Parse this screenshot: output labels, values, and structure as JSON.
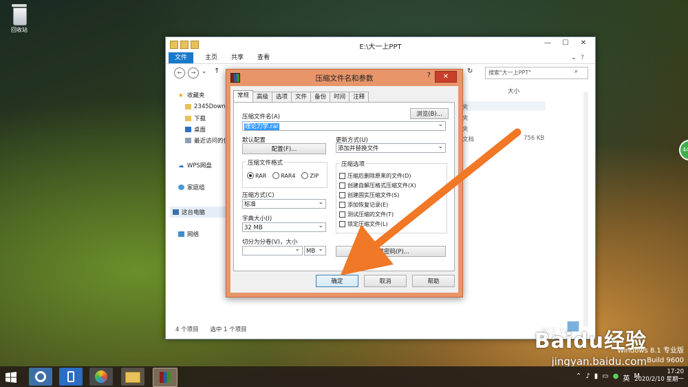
{
  "desktop": {
    "recycle_bin_label": "回收站"
  },
  "explorer": {
    "title": "E:\\大一上PPT",
    "ribbon_tabs": [
      "文件",
      "主页",
      "共享",
      "查看"
    ],
    "search_placeholder": "搜索\"大一上PPT\"",
    "nav_items": [
      {
        "label": "收藏夹",
        "icon": "star-icon"
      },
      {
        "label": "2345Down",
        "icon": "folder-icon"
      },
      {
        "label": "下载",
        "icon": "download-folder-icon"
      },
      {
        "label": "桌面",
        "icon": "desktop-icon"
      },
      {
        "label": "最近访问的位",
        "icon": "recent-icon"
      },
      {
        "label": "WPS网盘",
        "icon": "cloud-icon"
      },
      {
        "label": "家庭组",
        "icon": "homegroup-icon"
      },
      {
        "label": "这台电脑",
        "icon": "computer-icon"
      },
      {
        "label": "网络",
        "icon": "network-icon"
      }
    ],
    "column_size": "大小",
    "partial_types": [
      "夹",
      "夹",
      "夹"
    ],
    "partial_doc_type": "文档",
    "file_size": "756 KB",
    "status_items": "4 个项目",
    "status_selected": "选中 1 个项目"
  },
  "dialog": {
    "title": "压缩文件名和参数",
    "help": "?",
    "close": "✕",
    "tabs": [
      "常规",
      "高级",
      "选项",
      "文件",
      "备份",
      "时间",
      "注释"
    ],
    "archive_name_label": "压缩文件名(A)",
    "browse_button": "浏览(B)...",
    "archive_name_value": "理论力学.rar",
    "default_profile_label": "默认配置",
    "profiles_button": "配置(F)...",
    "update_mode_label": "更新方式(U)",
    "update_mode_value": "添加并替换文件",
    "format_group": "压缩文件格式",
    "formats": [
      {
        "label": "RAR",
        "checked": true
      },
      {
        "label": "RAR4",
        "checked": false
      },
      {
        "label": "ZIP",
        "checked": false
      }
    ],
    "method_label": "压缩方式(C)",
    "method_value": "标准",
    "dict_label": "字典大小(I)",
    "dict_value": "32 MB",
    "split_label": "切分为分卷(V)，大小",
    "split_unit": "MB",
    "options_group": "压缩选项",
    "options": [
      "压缩后删除原来的文件(D)",
      "创建自解压格式压缩文件(X)",
      "创建固实压缩文件(S)",
      "添加恢复记录(E)",
      "测试压缩的文件(T)",
      "锁定压缩文件(L)"
    ],
    "password_button": "设置密码(P)...",
    "ok_button": "确定",
    "cancel_button": "取消",
    "help_button": "帮助"
  },
  "watermark": {
    "logo_text": "Baidu经验",
    "url": "jingyan.baidu.com",
    "activate": "激活 Wi",
    "os_edition": "Windows 8.1 专业版",
    "build": "Build 9600"
  },
  "taskbar": {
    "ime": "英",
    "time": "17:20",
    "date": "2020/2/10 星期一"
  },
  "colors": {
    "dialog_frame": "#e8956a",
    "close_button": "#c7402a",
    "file_tab": "#1979ca",
    "arrow": "#f07826"
  }
}
